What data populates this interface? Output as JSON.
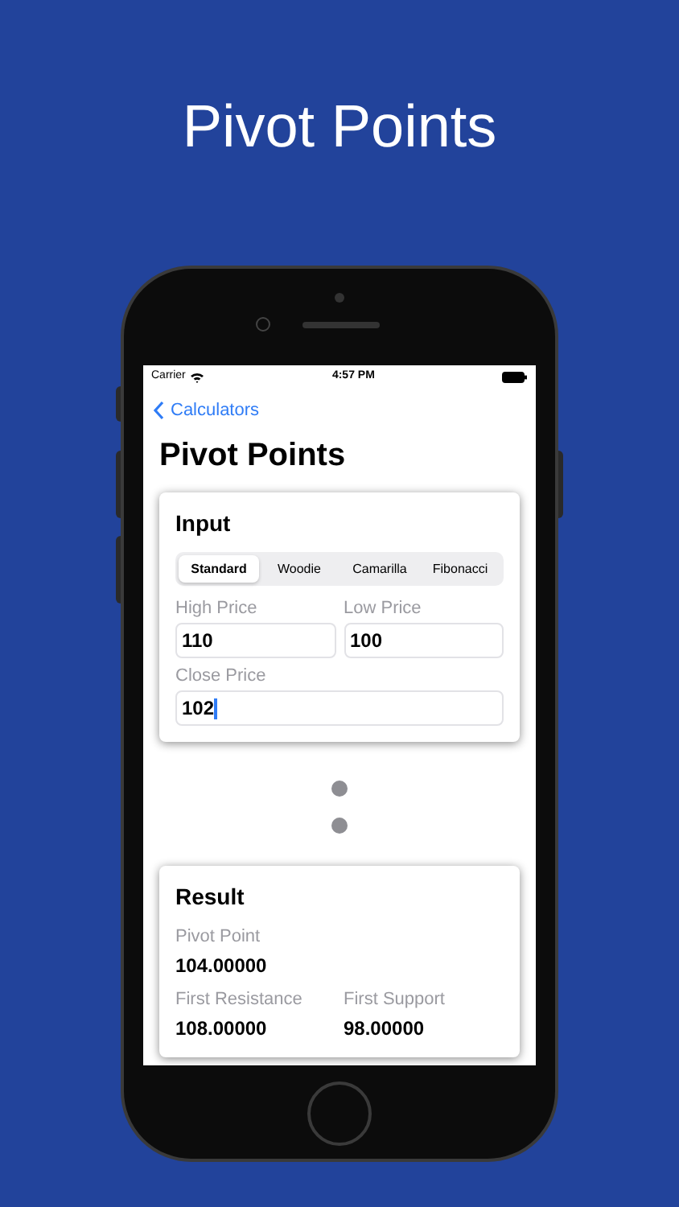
{
  "headline": "Pivot Points",
  "status_bar": {
    "carrier": "Carrier",
    "time": "4:57 PM"
  },
  "nav": {
    "back": "Calculators",
    "title": "Pivot Points"
  },
  "input_card": {
    "title": "Input",
    "tabs": [
      {
        "label": "Standard",
        "selected": true
      },
      {
        "label": "Woodie",
        "selected": false
      },
      {
        "label": "Camarilla",
        "selected": false
      },
      {
        "label": "Fibonacci",
        "selected": false
      }
    ],
    "fields": [
      {
        "label": "High Price",
        "value": "110",
        "focused": false
      },
      {
        "label": "Low Price",
        "value": "100",
        "focused": false
      },
      {
        "label": "Close Price",
        "value": "102",
        "focused": true
      }
    ]
  },
  "result_card": {
    "title": "Result",
    "items": [
      {
        "label": "Pivot Point",
        "value": "104.00000"
      },
      {
        "label": "First Resistance",
        "value": "108.00000"
      },
      {
        "label": "First Support",
        "value": "98.00000"
      }
    ]
  }
}
